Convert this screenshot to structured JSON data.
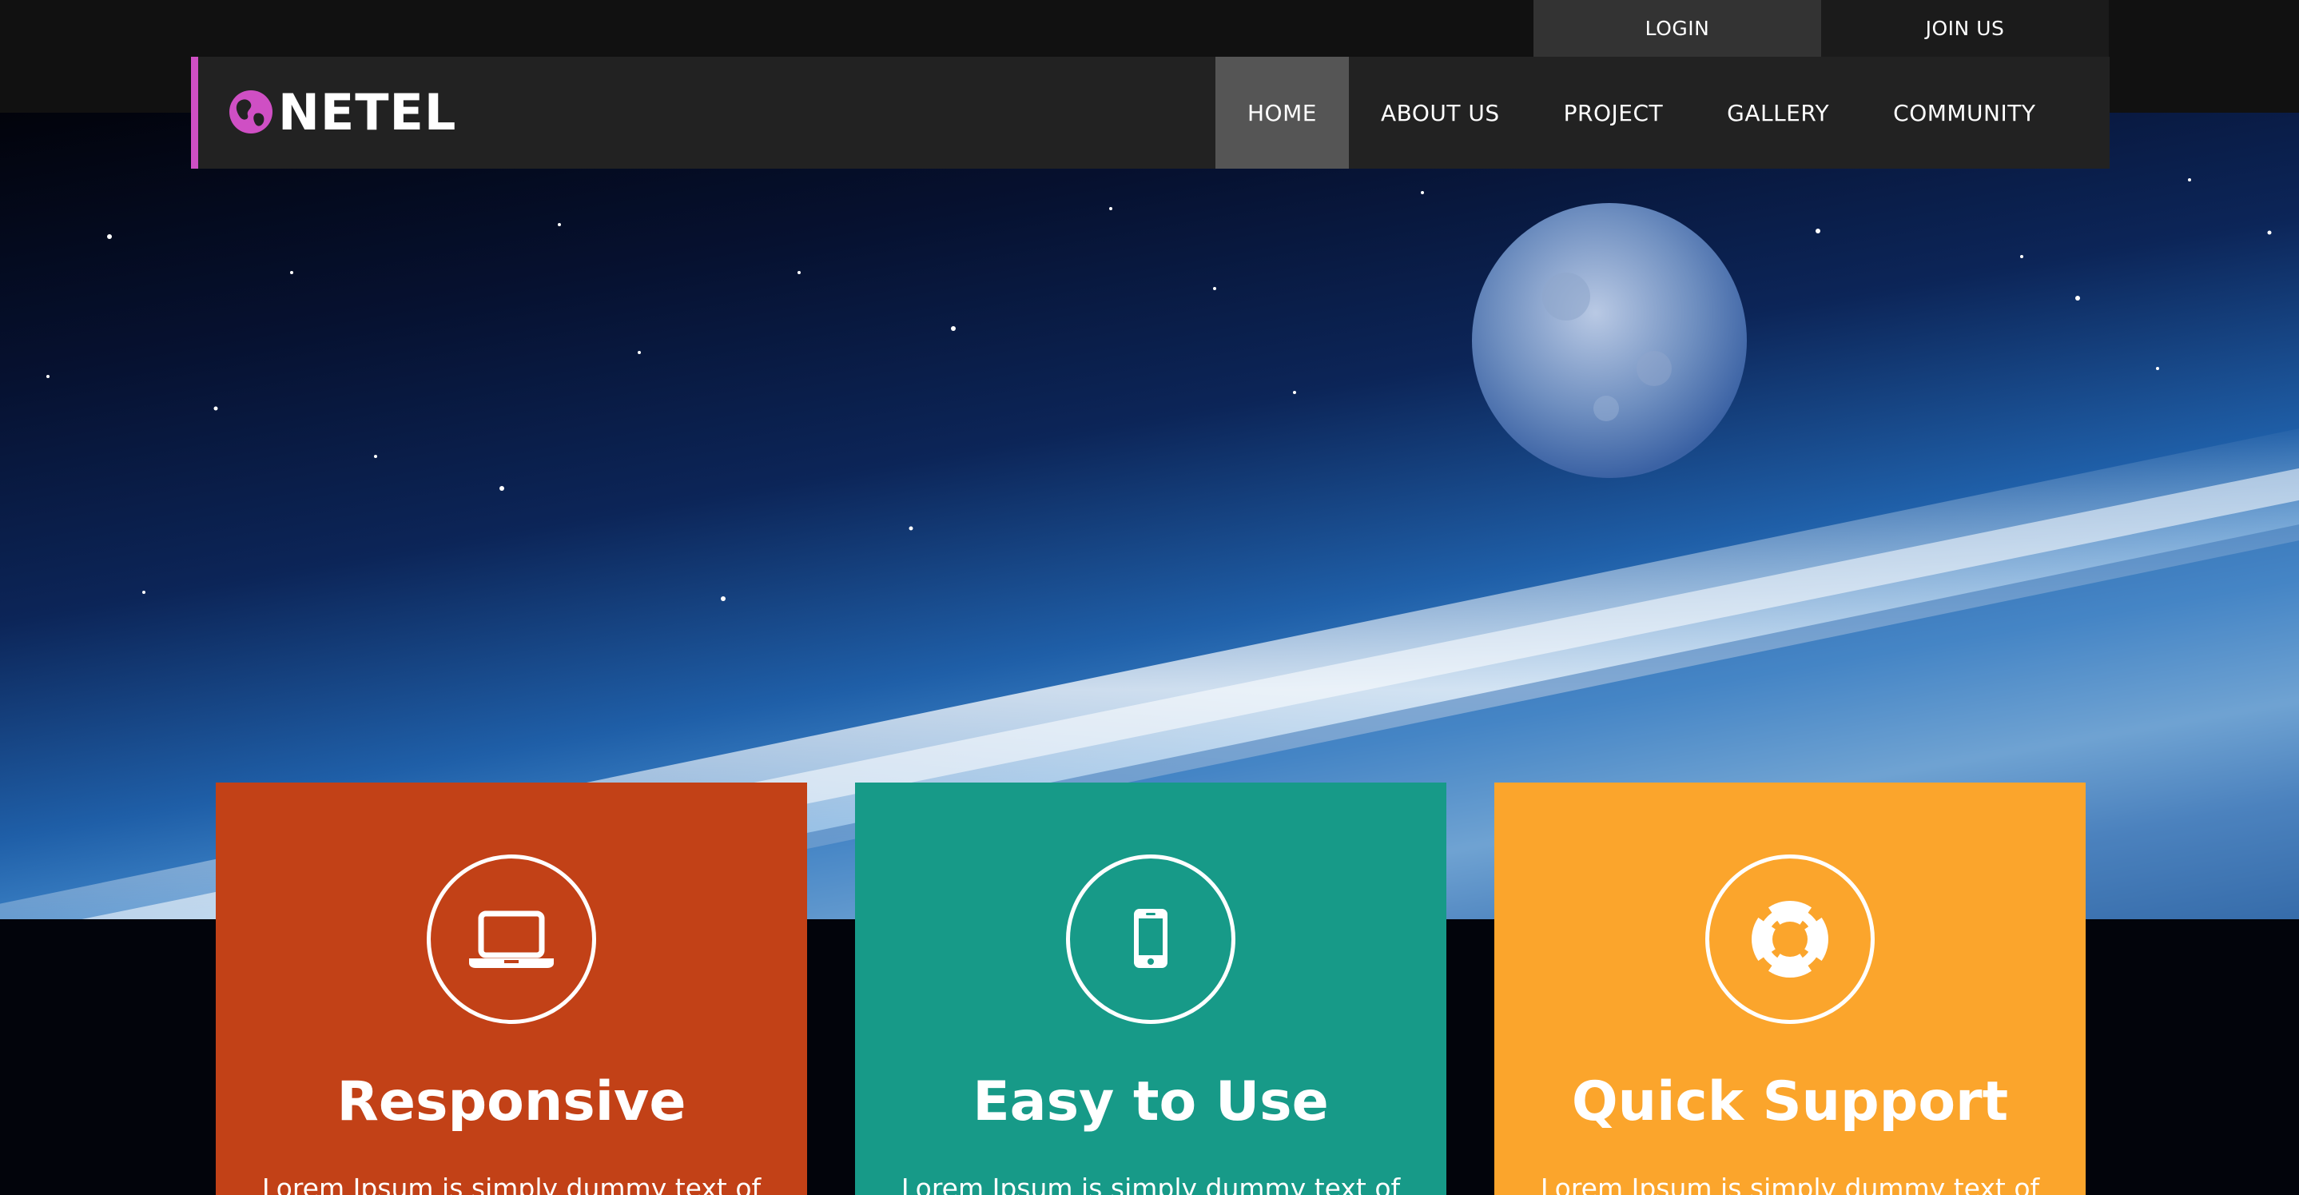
{
  "top_links": {
    "login": "LOGIN",
    "join": "JOIN US"
  },
  "brand": {
    "name": "NETEL",
    "accent_color": "#cf4fc4",
    "icon": "globe-icon"
  },
  "nav": {
    "items": [
      {
        "label": "HOME",
        "active": true
      },
      {
        "label": "ABOUT US",
        "active": false
      },
      {
        "label": "PROJECT",
        "active": false
      },
      {
        "label": "GALLERY",
        "active": false
      },
      {
        "label": "COMMUNITY",
        "active": false
      }
    ]
  },
  "features": [
    {
      "title": "Responsive",
      "text": "Lorem Ipsum is simply dummy text of",
      "color": "#c24117",
      "icon": "laptop-icon"
    },
    {
      "title": "Easy to Use",
      "text": "Lorem Ipsum is simply dummy text of",
      "color": "#179a88",
      "icon": "smartphone-icon"
    },
    {
      "title": "Quick Support",
      "text": "Lorem Ipsum is simply dummy text of",
      "color": "#fba52c",
      "icon": "lifebuoy-icon"
    }
  ]
}
